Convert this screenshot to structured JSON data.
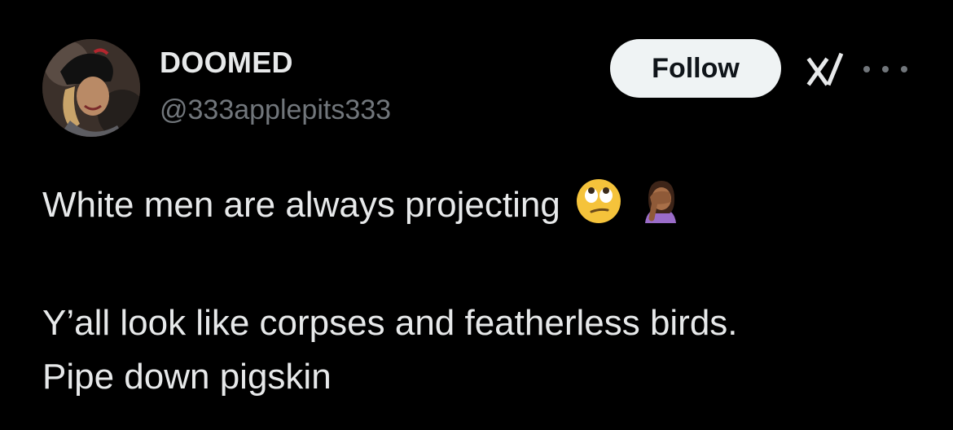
{
  "author": {
    "display_name": "DOOMED",
    "handle": "@333applepits333"
  },
  "actions": {
    "follow_label": "Follow"
  },
  "icons": {
    "grok": "xai-grok-icon",
    "more": "more-options-icon",
    "emoji_1": "face-with-rolling-eyes",
    "emoji_2": "person-facepalming-medium-dark-skin"
  },
  "tweet": {
    "line1": "White men are always projecting",
    "line2": "Y’all look like corpses and featherless birds.",
    "line3": "Pipe down pigskin"
  },
  "colors": {
    "background": "#000000",
    "text": "#e7e9ea",
    "secondary_text": "#71767b",
    "button_bg": "#eff3f4"
  }
}
